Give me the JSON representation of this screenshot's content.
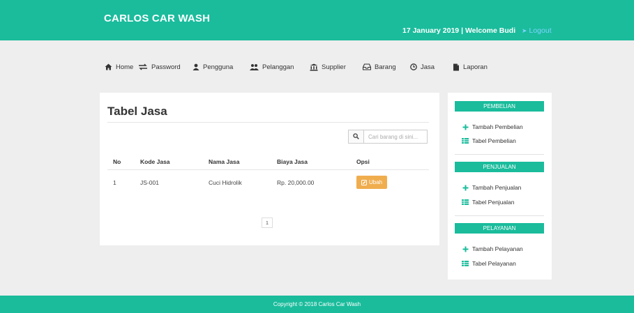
{
  "header": {
    "brand": "CARLOS CAR WASH",
    "date": "17 January 2019",
    "separator": "|",
    "welcome": "Welcome Budi",
    "logout": "Logout"
  },
  "nav": [
    {
      "label": "Home",
      "icon": "home-icon"
    },
    {
      "label": "Password",
      "icon": "exchange-icon"
    },
    {
      "label": "Pengguna",
      "icon": "user-icon"
    },
    {
      "label": "Pelanggan",
      "icon": "users-icon"
    },
    {
      "label": "Supplier",
      "icon": "bank-icon"
    },
    {
      "label": "Barang",
      "icon": "inbox-icon"
    },
    {
      "label": "Jasa",
      "icon": "clock-icon"
    },
    {
      "label": "Laporan",
      "icon": "file-icon"
    }
  ],
  "main": {
    "title": "Tabel Jasa",
    "search_placeholder": "Cari barang di sini...",
    "columns": [
      "No",
      "Kode Jasa",
      "Nama Jasa",
      "Biaya Jasa",
      "Opsi"
    ],
    "rows": [
      {
        "no": "1",
        "kode": "JS-001",
        "nama": "Cuci Hidrolik",
        "biaya": "Rp. 20,000.00",
        "action": "Ubah"
      }
    ],
    "page": "1"
  },
  "sidebar": {
    "sections": [
      {
        "title": "PEMBELIAN",
        "links": [
          "Tambah Pembelian",
          "Tabel Pembelian"
        ]
      },
      {
        "title": "PENJUALAN",
        "links": [
          "Tambah Penjualan",
          "Tabel Penjualan"
        ]
      },
      {
        "title": "PELAYANAN",
        "links": [
          "Tambah Pelayanan",
          "Tabel Pelayanan"
        ]
      }
    ]
  },
  "footer": {
    "copyright": "Copyright © 2018 Carlos Car Wash"
  },
  "colors": {
    "accent": "#1abc9c",
    "warning": "#f0ad4e",
    "link": "#7fd3ff"
  }
}
